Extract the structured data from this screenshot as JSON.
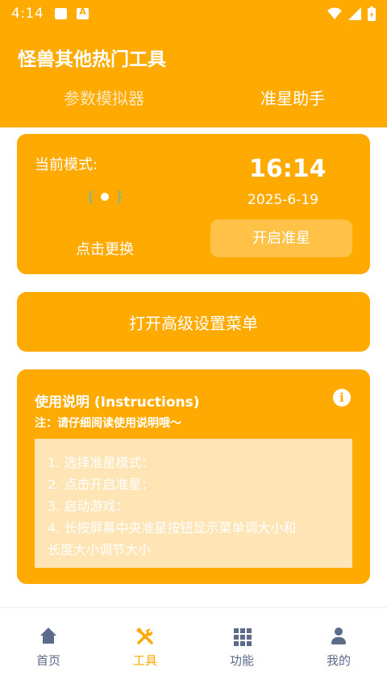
{
  "statusbar": {
    "time": "4:14"
  },
  "header": {
    "title": "怪兽其他热门工具",
    "tabs": [
      {
        "label": "参数模拟器",
        "active": false
      },
      {
        "label": "准星助手",
        "active": true
      }
    ]
  },
  "mode_card": {
    "mode_label": "当前模式:",
    "toggle_left": "{",
    "toggle_right": "}",
    "switch_label": "点击更换",
    "clock": "16:14",
    "date": "2025-6-19",
    "start_button": "开启准星"
  },
  "advanced_button": {
    "label": "打开高级设置菜单"
  },
  "instructions": {
    "title": "使用说明 (Instructions)",
    "note": "注：请仔细阅读使用说明哦～",
    "steps": [
      "1. 选择准星模式：",
      "2. 点击开启准星：",
      "3. 启动游戏：",
      "4. 长按屏幕中央准星按钮显示菜单调大小和",
      "长度大小调节大小"
    ]
  },
  "bottom_nav": [
    {
      "label": "首页",
      "icon": "home-icon",
      "active": false
    },
    {
      "label": "工具",
      "icon": "tools-icon",
      "active": true
    },
    {
      "label": "功能",
      "icon": "grid-icon",
      "active": false
    },
    {
      "label": "我的",
      "icon": "user-icon",
      "active": false
    }
  ],
  "colors": {
    "accent": "#ffaa00",
    "nav_inactive": "#5c6b8a",
    "instr_box": "#ffe4b5"
  }
}
